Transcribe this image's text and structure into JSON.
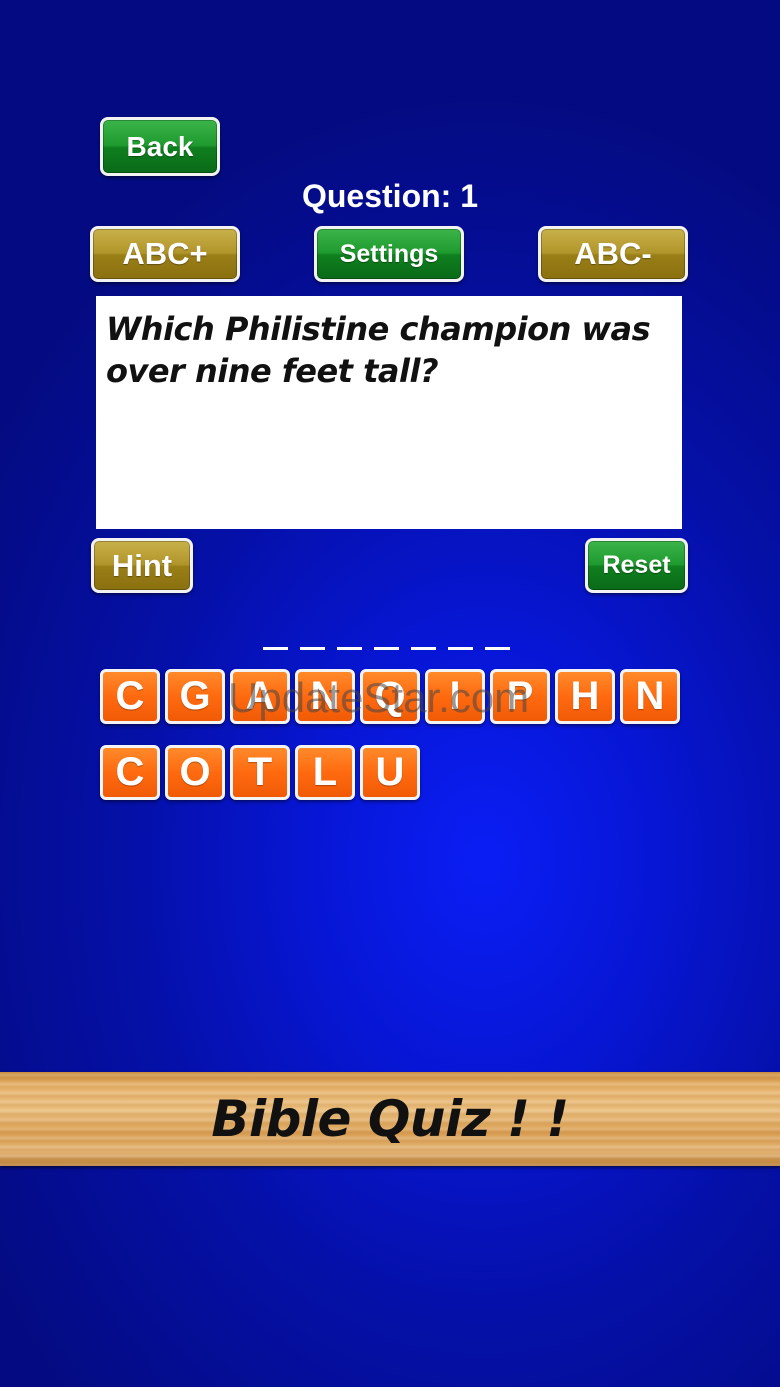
{
  "header": {
    "back_label": "Back",
    "question_label": "Question: 1"
  },
  "toolbar": {
    "abc_plus_label": "ABC+",
    "settings_label": "Settings",
    "abc_minus_label": "ABC-"
  },
  "question": {
    "text": "Which Philistine champion was over nine feet tall?"
  },
  "controls": {
    "hint_label": "Hint",
    "reset_label": "Reset"
  },
  "answer": {
    "slot_count": 7
  },
  "tiles": {
    "row1": [
      "C",
      "G",
      "A",
      "N",
      "Q",
      "I",
      "P",
      "H",
      "N"
    ],
    "row2": [
      "C",
      "O",
      "T",
      "L",
      "U"
    ]
  },
  "watermark": "UpdateStar.com",
  "banner": {
    "title": "Bible Quiz ! !"
  },
  "colors": {
    "background": "#0716d4",
    "green_button": "#1f9a2f",
    "gold_button": "#b0952a",
    "tile": "#ff6a10"
  }
}
